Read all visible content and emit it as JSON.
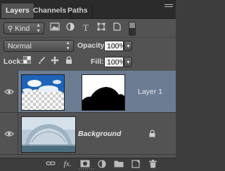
{
  "tabs": [
    {
      "label": "Layers",
      "active": true
    },
    {
      "label": "Channels",
      "active": false
    },
    {
      "label": "Paths",
      "active": false
    }
  ],
  "filter": {
    "label": "Kind"
  },
  "blend_mode": {
    "value": "Normal"
  },
  "opacity": {
    "label": "Opacity:",
    "value": "100%"
  },
  "lock": {
    "label": "Lock:"
  },
  "fill": {
    "label": "Fill:",
    "value": "100%"
  },
  "layers": [
    {
      "name": "Layer 1",
      "selected": true,
      "italic": false
    },
    {
      "name": "Background",
      "selected": false,
      "italic": true,
      "locked": true
    }
  ],
  "colors": {
    "selection": "#6c7c93",
    "panel": "#535353"
  }
}
